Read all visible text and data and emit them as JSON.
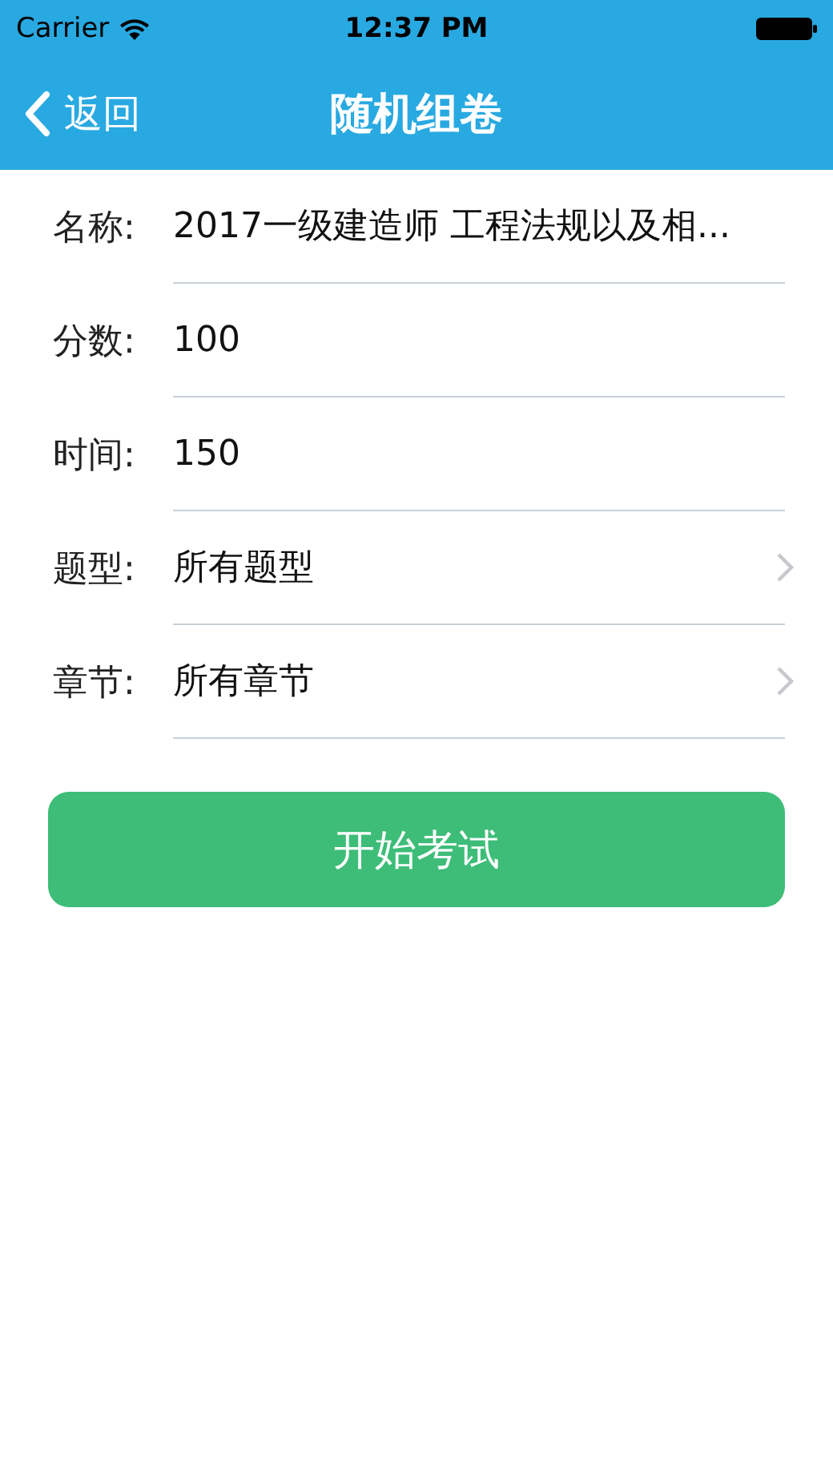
{
  "status_bar": {
    "carrier": "Carrier",
    "time": "12:37 PM"
  },
  "nav": {
    "back": "返回",
    "title": "随机组卷"
  },
  "fields": [
    {
      "kind": "text",
      "label": "名称:",
      "value": "2017一级建造师 工程法规以及相..."
    },
    {
      "kind": "text",
      "label": "分数:",
      "value": "100"
    },
    {
      "kind": "text",
      "label": "时间:",
      "value": "150"
    },
    {
      "kind": "select",
      "label": "题型:",
      "value": "所有题型"
    },
    {
      "kind": "select",
      "label": "章节:",
      "value": "所有章节"
    }
  ],
  "start_button": "开始考试"
}
